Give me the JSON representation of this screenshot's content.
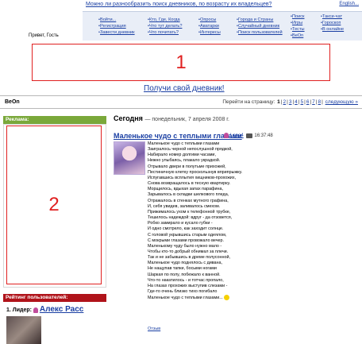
{
  "top": {
    "question": "Можно ли разнообразить поиск дневников, по возрасту их владельцев?",
    "english": "English..."
  },
  "nav": {
    "col1": [
      "Войти...",
      "Регистрация",
      "Завести дневник"
    ],
    "col2": [
      "Кто, Где, Когда",
      "Что тут делать?",
      "Что почитать?"
    ],
    "col3": [
      "Опросы",
      "Аватарки",
      "Интересы"
    ],
    "col4": [
      "Города и Страны",
      "Случайный дневник",
      "Поиск пользователей"
    ],
    "col5": [
      "Поиск",
      "Игры",
      "Тесты",
      "BeOn"
    ],
    "col6": [
      "Такси-чат",
      "Гороскоп",
      "В онлайне"
    ]
  },
  "greeting": "Привет, Гость",
  "ad_top_number": "1",
  "get_diary": "Получи свой дневник!",
  "site_name": "BeOn",
  "pagination": {
    "label": "Перейти на страницу:",
    "pages": [
      "1",
      "2",
      "3",
      "4",
      "5",
      "6",
      "7",
      "8"
    ],
    "current": "1",
    "next": "следующую »"
  },
  "sidebar": {
    "ad_header": "Реклама:",
    "ad_number": "2",
    "rating_header": "Рейтинг пользователей:",
    "leader_label": "1. Лидер:",
    "leader_name": "Алекс Расс"
  },
  "main": {
    "today": "Сегодня",
    "date": "— понедельник, 7 апреля 2008 г."
  },
  "post": {
    "title": "Маленькое чудо с теплыми глазами",
    "author": "Lena4",
    "time": "16:37:48",
    "lines": [
      "Маленькое чудо с теплыми глазами",
      "Заигралось черной непослушной прядкой,",
      "Набирало номер долгими часами,",
      "Нежно улыбаясь, плакало украдкой.",
      "Отрывало двери в полутьме прихожей,",
      "Пестиничную клетку проскользнув вприпрыжку.",
      "Испугавшись всплытия хищников-прохожих,",
      "Снова возвращалось в тесную квартирку.",
      "Морщилось, вдыхая запах парафина,",
      "Зарывалось в складки шелкового пледа,",
      "Отражалось в стенках мутного графина,",
      "И, себя увидев, заливалось смехом.",
      "Прижималось ухом к телефонной трубке,",
      "Тешилось надеждой: вдруг - да отзовется,",
      "Робко замирало и кусало губки -",
      "И одно смотрело, как заходит солнце.",
      "С головой укрывшись старым одеялом,",
      "С мокрыми глазами провожало вечер.",
      "Маленькому чуду было нужно мало -",
      "Чтобы кто-то добрый обнимал за плечи.",
      "Так и не забывшись в дреме полусонной,",
      "Маленькое чудо поднялось с дивана,",
      "Не нащупав тапки, босыми ногами",
      "Шаркая по полу, побежало к ванной.",
      "Что-то накатилось - и тотчас пропало,",
      "На глазах прохожих выступив слезами -",
      "Где-то очень близко тихо погибало",
      "Маленькое чудо с теплыми глазами..."
    ],
    "comments": "Отзыв"
  }
}
